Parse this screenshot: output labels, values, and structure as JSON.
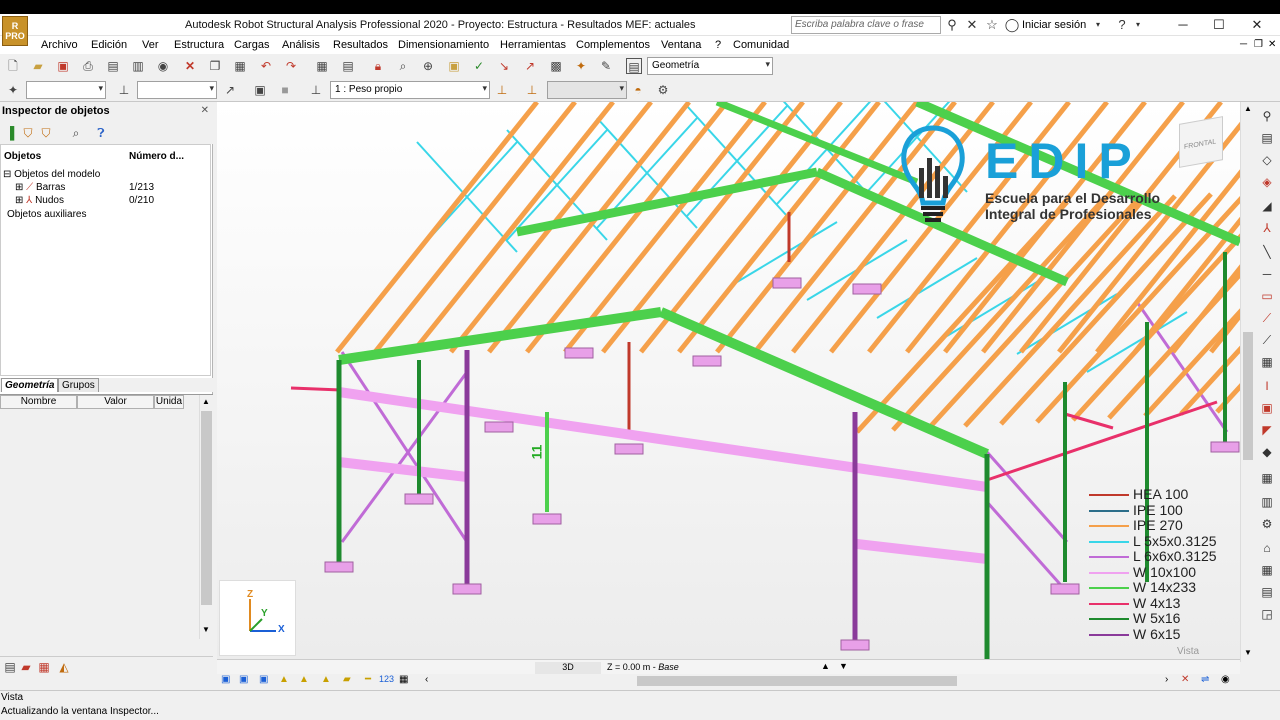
{
  "window": {
    "title": "Autodesk Robot Structural Analysis Professional 2020 - Proyecto: Estructura - Resultados MEF: actuales",
    "logo_text": "R PRO",
    "search_placeholder": "Escriba palabra clave o frase",
    "signin": "Iniciar sesión"
  },
  "menu": [
    "Archivo",
    "Edición",
    "Ver",
    "Estructura",
    "Cargas",
    "Análisis",
    "Resultados",
    "Dimensionamiento",
    "Herramientas",
    "Complementos",
    "Ventana",
    "?",
    "Comunidad"
  ],
  "toolbar": {
    "view_combo": "Geometría",
    "load_case_combo": "1 : Peso propio"
  },
  "inspector": {
    "title": "Inspector de objetos",
    "col_objects": "Objetos",
    "col_number": "Número d...",
    "tree": {
      "model_objects": "Objetos del modelo",
      "bars_label": "Barras",
      "bars_count": "1/213",
      "nodes_label": "Nudos",
      "nodes_count": "0/210",
      "aux_objects": "Objetos auxiliares"
    },
    "tabs": [
      "Geometría",
      "Grupos"
    ],
    "prop_headers": [
      "Nombre",
      "Valor",
      "Unida"
    ]
  },
  "viewport": {
    "mode": "3D",
    "level": "Z = 0.00 m - ",
    "level_name": "Base",
    "view_label": "Vista",
    "selected_bar_label": "11",
    "cube_label": "FRONTAL",
    "axis_x": "X",
    "axis_y": "Y",
    "axis_z": "Z"
  },
  "watermark": {
    "brand": "EDIP",
    "line1": "Escuela para el Desarrollo",
    "line2": "Integral de Profesionales"
  },
  "legend": [
    {
      "name": "HEA 100",
      "color": "#c0392b"
    },
    {
      "name": "IPE 100",
      "color": "#2c6e8a"
    },
    {
      "name": "IPE 270",
      "color": "#f5a04a"
    },
    {
      "name": "L 5x5x0.3125",
      "color": "#39d6e8"
    },
    {
      "name": "L 6x6x0.3125",
      "color": "#c06bd6"
    },
    {
      "name": "W 10x100",
      "color": "#f0a2f0"
    },
    {
      "name": "W 14x233",
      "color": "#4cd04c"
    },
    {
      "name": "W 4x13",
      "color": "#e8306a"
    },
    {
      "name": "W 5x16",
      "color": "#1e8a2e"
    },
    {
      "name": "W 6x15",
      "color": "#8a3a9a"
    }
  ],
  "status": {
    "left": "Vista",
    "message": "Actualizando la ventana Inspector..."
  }
}
